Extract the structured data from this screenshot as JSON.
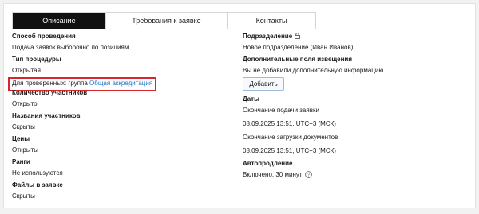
{
  "tabs": [
    {
      "label": "Описание",
      "active": true
    },
    {
      "label": "Требования к заявке",
      "active": false
    },
    {
      "label": "Контакты",
      "active": false
    }
  ],
  "left": {
    "method": {
      "label": "Способ проведения",
      "value": "Подача заявок выборочно по позициям"
    },
    "procedure": {
      "label": "Тип процедуры",
      "value": "Открытая",
      "verified_prefix": "Для проверенных: группа",
      "verified_link": "Общая аккредитация"
    },
    "participants": {
      "label": "Количество участников",
      "value": "Открыто"
    },
    "names": {
      "label": "Названия участников",
      "value": "Скрыты"
    },
    "prices": {
      "label": "Цены",
      "value": "Открыты"
    },
    "ranks": {
      "label": "Ранги",
      "value": "Не используются"
    },
    "files": {
      "label": "Файлы в заявке",
      "value": "Скрыты"
    }
  },
  "right": {
    "division": {
      "label": "Подразделение",
      "value": "Новое подразделение (Иван Иванов)",
      "icon": "lock-icon"
    },
    "extra_fields": {
      "label": "Дополнительные поля извещения",
      "value": "Вы не добавили дополнительную информацию.",
      "button": "Добавить"
    },
    "dates": {
      "label": "Даты",
      "submission_label": "Окончание подачи заявки",
      "submission_value": "08.09.2025 13:51, UTC+3 (МСК)",
      "docs_label": "Окончание загрузки документов",
      "docs_value": "08.09.2025 13:51, UTC+3 (МСК)"
    },
    "autoextend": {
      "label": "Автопродление",
      "value": "Включено, 30 минут",
      "icon": "help-icon"
    }
  },
  "colors": {
    "highlight": "#d6262e",
    "link": "#1a73c9",
    "active_tab": "#111111"
  }
}
